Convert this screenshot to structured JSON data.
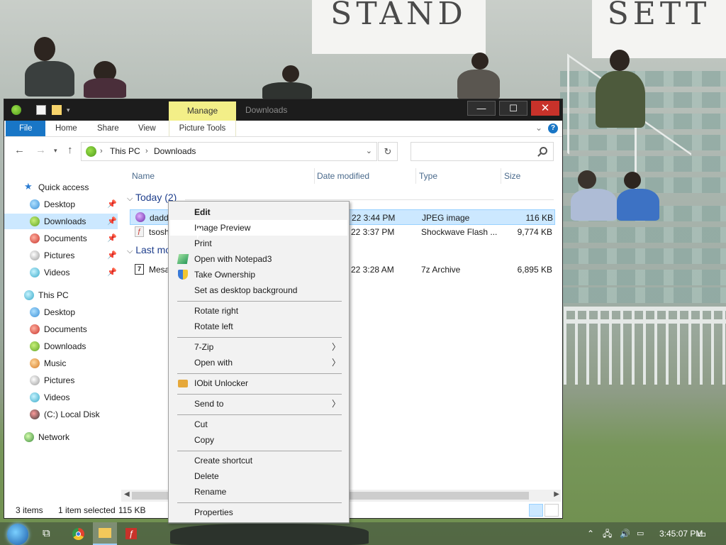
{
  "window": {
    "title": "Downloads",
    "manage_tab": "Manage",
    "minimize": "—",
    "maximize": "☐",
    "close": "✕"
  },
  "ribbon": {
    "tabs": [
      "File",
      "Home",
      "Share",
      "View",
      "Picture Tools"
    ],
    "help": "?"
  },
  "address": {
    "segments": [
      "This PC",
      "Downloads"
    ],
    "search_placeholder": ""
  },
  "navpane": {
    "quick_access": "Quick access",
    "quick_items": [
      "Desktop",
      "Downloads",
      "Documents",
      "Pictures",
      "Videos"
    ],
    "this_pc": "This PC",
    "pc_items": [
      "Desktop",
      "Documents",
      "Downloads",
      "Music",
      "Pictures",
      "Videos",
      "(C:) Local Disk"
    ],
    "network": "Network"
  },
  "filelist": {
    "columns": [
      "Name",
      "Date modified",
      "Type",
      "Size"
    ],
    "groups": [
      {
        "label": "Today (2)"
      },
      {
        "label": "Last mo"
      }
    ],
    "rows": [
      {
        "name": "daddy",
        "date": "22 3:44 PM",
        "type": "JPEG image",
        "size": "116 KB"
      },
      {
        "name": "tsoshe",
        "date": "22 3:37 PM",
        "type": "Shockwave Flash ...",
        "size": "9,774 KB"
      },
      {
        "name": "MesaF",
        "date": "22 3:28 AM",
        "type": "7z Archive",
        "size": "6,895 KB"
      }
    ]
  },
  "statusbar": {
    "items": "3 items",
    "selected": "1 item selected",
    "size": "115 KB"
  },
  "context_menu": {
    "items": [
      "Edit",
      "Image Preview",
      "Print",
      "Open with Notepad3",
      "Take Ownership",
      "Set as desktop background",
      "Rotate right",
      "Rotate left",
      "7-Zip",
      "Open with",
      "IObit Unlocker",
      "Send to",
      "Cut",
      "Copy",
      "Create shortcut",
      "Delete",
      "Rename",
      "Properties"
    ]
  },
  "taskbar": {
    "clock": "3:45:07 PM"
  },
  "wallpaper": {
    "sign_left": "STAND",
    "sign_right": "SETT"
  },
  "colors": {
    "accent": "#1976c6",
    "manage_tab": "#f3ef88",
    "selection": "#cce8ff",
    "close_button": "#c8322a"
  }
}
